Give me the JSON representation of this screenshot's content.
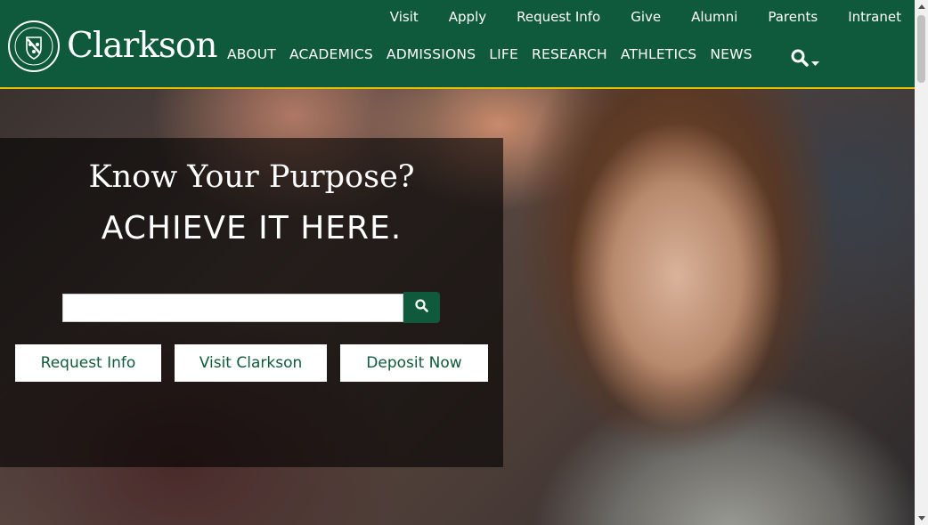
{
  "brand": {
    "name": "Clarkson",
    "seal_text": "CLARKSON UNIVERSITY · TECHNOLOGY ·",
    "primary_color": "#0f5a3c",
    "accent_color": "#e7c000"
  },
  "utility_nav": [
    "Visit",
    "Apply",
    "Request Info",
    "Give",
    "Alumni",
    "Parents",
    "Intranet"
  ],
  "main_nav": [
    "ABOUT",
    "ACADEMICS",
    "ADMISSIONS",
    "LIFE",
    "RESEARCH",
    "ATHLETICS",
    "NEWS"
  ],
  "search_toggle": {
    "icon": "search-icon",
    "caret": "caret-down-icon"
  },
  "hero": {
    "title_line1": "Know Your Purpose?",
    "title_line2": "ACHIEVE IT HERE.",
    "search": {
      "value": "",
      "placeholder": "",
      "button_icon": "search-icon"
    },
    "buttons": [
      "Request Info",
      "Visit Clarkson",
      "Deposit Now"
    ]
  }
}
